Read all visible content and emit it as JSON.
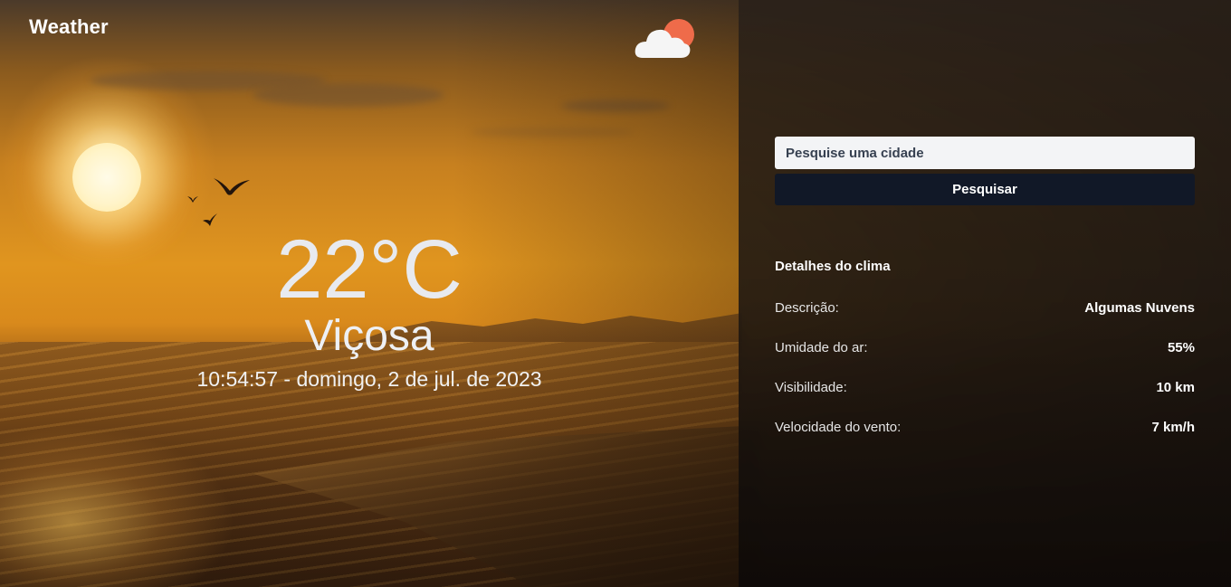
{
  "app": {
    "brand": "Weather",
    "weather_icon": "cloud-sun-icon"
  },
  "current": {
    "temperature": "22°C",
    "city": "Viçosa",
    "datetime": "10:54:57 - domingo, 2 de jul. de 2023"
  },
  "search": {
    "placeholder": "Pesquise uma cidade",
    "value": "",
    "button_label": "Pesquisar"
  },
  "details": {
    "title": "Detalhes do clima",
    "rows": [
      {
        "label": "Descrição:",
        "value": "Algumas Nuvens"
      },
      {
        "label": "Umidade do ar:",
        "value": "55%"
      },
      {
        "label": "Visibilidade:",
        "value": "10 km"
      },
      {
        "label": "Velocidade do vento:",
        "value": "7 km/h"
      }
    ]
  },
  "colors": {
    "search_button_bg": "#111827",
    "input_bg": "#f3f4f6",
    "icon_sun": "#ef6b4a",
    "icon_cloud": "#f5f5f5"
  }
}
